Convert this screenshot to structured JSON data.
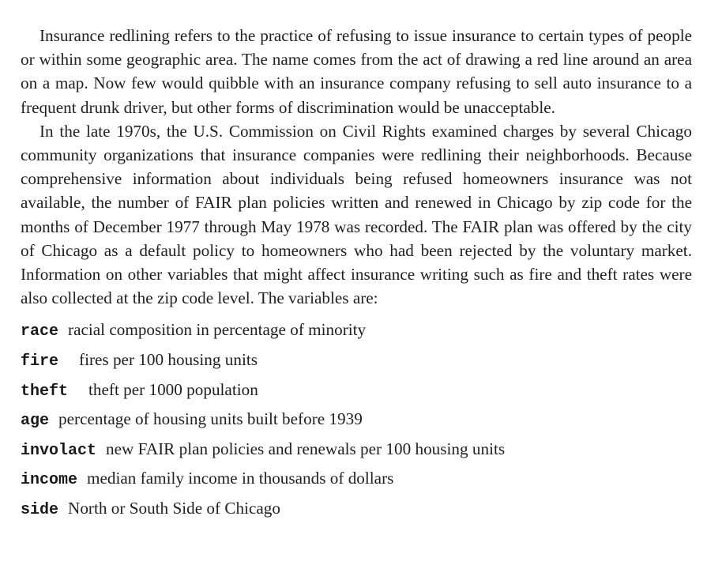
{
  "paragraphs": [
    "Insurance redlining refers to the practice of refusing to issue insurance to certain types of people or within some geographic area. The name comes from the act of drawing a red line around an area on a map. Now few would quibble with an insur­ance company refusing to sell auto insurance to a frequent drunk driver, but other forms of discrimination would be unacceptable.",
    "In the late 1970s, the U.S. Commission on Civil Rights examined charges by sev­eral Chicago community organizations that insurance companies were redlining their neighborhoods. Because comprehensive information about individuals being refused homeowners insurance was not available, the number of FAIR plan policies written and renewed in Chicago by zip code for the months of December 1977 through May 1978 was recorded. The FAIR plan was offered by the city of Chicago as a default policy to homeowners who had been rejected by the voluntary market. Information on other variables that might affect insurance writing such as fire and theft rates were also collected at the zip code level. The variables are:"
  ],
  "variables": [
    {
      "name": "race",
      "description": "racial composition in percentage of minority"
    },
    {
      "name": "fire",
      "description": "fires per 100 housing units"
    },
    {
      "name": "theft",
      "description": "theft per 1000 population"
    },
    {
      "name": "age",
      "description": "percentage of housing units built before 1939"
    },
    {
      "name": "involact",
      "description": "new FAIR plan policies and renewals per 100 housing units"
    },
    {
      "name": "income",
      "description": "median family income in thousands of dollars"
    },
    {
      "name": "side",
      "description": "North or South Side of Chicago"
    }
  ]
}
